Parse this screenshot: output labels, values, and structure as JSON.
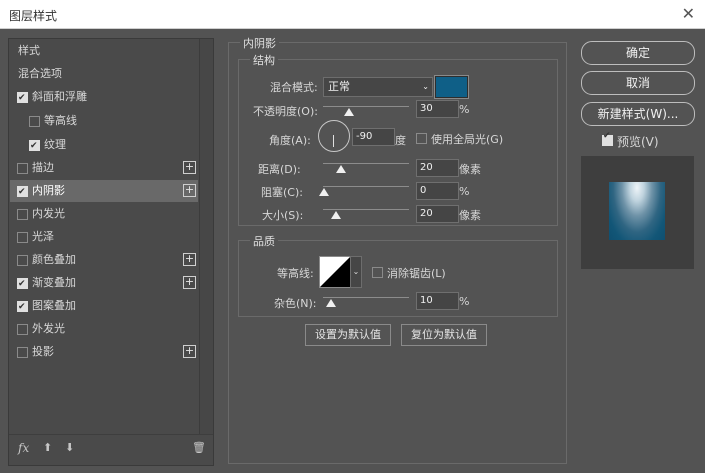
{
  "window": {
    "title": "图层样式",
    "close_glyph": "✕"
  },
  "left_list": {
    "items": [
      {
        "label": "样式",
        "has_checkbox": false
      },
      {
        "label": "混合选项",
        "has_checkbox": false
      },
      {
        "label": "斜面和浮雕",
        "checked": true
      },
      {
        "label": "等高线",
        "checked": false,
        "indent": true
      },
      {
        "label": "纹理",
        "checked": true,
        "indent": true
      },
      {
        "label": "描边",
        "checked": false,
        "plus": true
      },
      {
        "label": "内阴影",
        "checked": true,
        "plus": true,
        "selected": true
      },
      {
        "label": "内发光",
        "checked": false
      },
      {
        "label": "光泽",
        "checked": false
      },
      {
        "label": "颜色叠加",
        "checked": false,
        "plus": true
      },
      {
        "label": "渐变叠加",
        "checked": true,
        "plus": true
      },
      {
        "label": "图案叠加",
        "checked": true
      },
      {
        "label": "外发光",
        "checked": false
      },
      {
        "label": "投影",
        "checked": false,
        "plus": true
      }
    ],
    "fx_label": "fx",
    "up_arrow": "⬆",
    "down_arrow": "⬇",
    "trash_icon": "🗑"
  },
  "panel": {
    "section_title": "内阴影",
    "structure_title": "结构",
    "blend_mode_label": "混合模式:",
    "blend_mode_value": "正常",
    "swatch_color": "#0f5f87",
    "opacity_label": "不透明度(O):",
    "opacity_value": "30",
    "angle_label": "角度(A):",
    "angle_value": "-90",
    "angle_unit": "度",
    "global_light_label": "使用全局光(G)",
    "distance_label": "距离(D):",
    "distance_value": "20",
    "choke_label": "阻塞(C):",
    "choke_value": "0",
    "size_label": "大小(S):",
    "size_value": "20",
    "pixel_unit": "像素",
    "percent_unit": "%",
    "quality_title": "品质",
    "contour_label": "等高线:",
    "antialias_label": "消除锯齿(L)",
    "noise_label": "杂色(N):",
    "noise_value": "10",
    "set_default_label": "设置为默认值",
    "reset_default_label": "复位为默认值"
  },
  "right": {
    "ok_label": "确定",
    "cancel_label": "取消",
    "new_style_label": "新建样式(W)...",
    "preview_label": "预览(V)"
  }
}
